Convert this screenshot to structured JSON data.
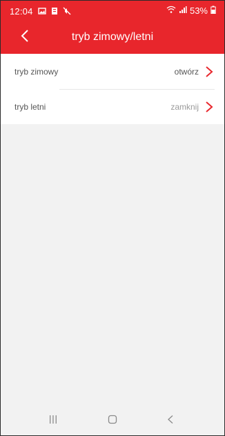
{
  "status_bar": {
    "time": "12:04",
    "battery": "53%",
    "icons": [
      "gallery-icon",
      "notification-icon",
      "mute-icon",
      "wifi-icon",
      "signal-icon",
      "battery-icon"
    ]
  },
  "header": {
    "title": "tryb zimowy/letni",
    "back_icon": "back-chevron-icon"
  },
  "list": {
    "items": [
      {
        "label": "tryb zimowy",
        "value": "otwórz",
        "value_state": "active"
      },
      {
        "label": "tryb letni",
        "value": "zamknij",
        "value_state": "muted"
      }
    ]
  },
  "nav_bar": {
    "buttons": [
      "recent-apps-icon",
      "home-icon",
      "back-icon"
    ]
  },
  "colors": {
    "accent": "#e8262c",
    "background": "#f2f2f2",
    "row_background": "#ffffff"
  }
}
